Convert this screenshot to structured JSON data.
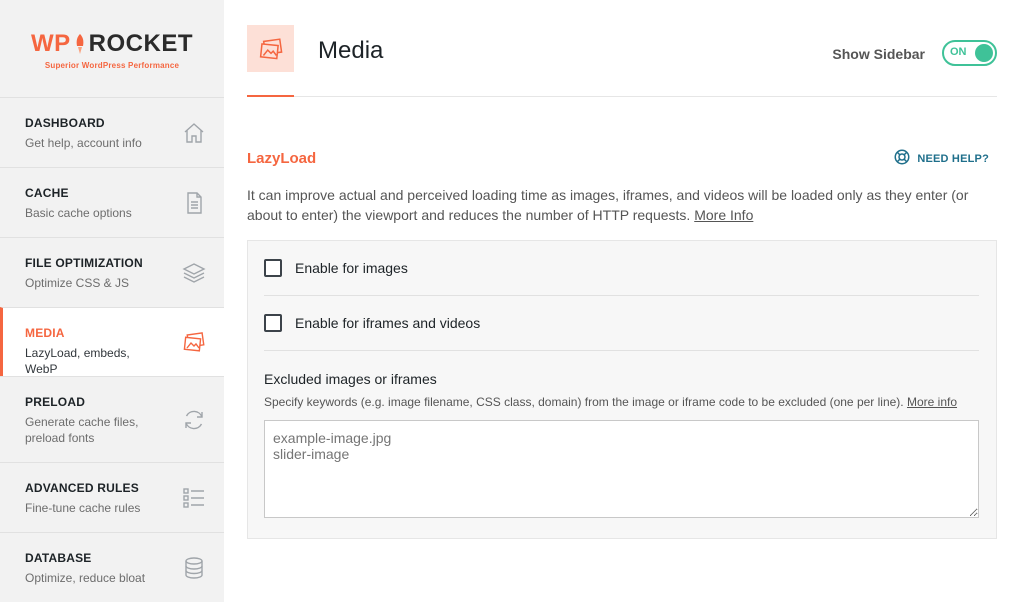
{
  "logo": {
    "brand_wp": "WP",
    "brand_rocket": "ROCKET",
    "tagline": "Superior WordPress Performance"
  },
  "sidebar": {
    "items": [
      {
        "title": "DASHBOARD",
        "desc": "Get help, account info",
        "icon": "home-icon"
      },
      {
        "title": "CACHE",
        "desc": "Basic cache options",
        "icon": "document-icon"
      },
      {
        "title": "FILE OPTIMIZATION",
        "desc": "Optimize CSS & JS",
        "icon": "layers-icon"
      },
      {
        "title": "MEDIA",
        "desc": "LazyLoad, embeds, WebP",
        "icon": "images-icon",
        "active": true
      },
      {
        "title": "PRELOAD",
        "desc": "Generate cache files, preload fonts",
        "icon": "refresh-icon"
      },
      {
        "title": "ADVANCED RULES",
        "desc": "Fine-tune cache rules",
        "icon": "checklist-icon"
      },
      {
        "title": "DATABASE",
        "desc": "Optimize, reduce bloat",
        "icon": "database-icon"
      }
    ]
  },
  "header": {
    "title": "Media",
    "show_sidebar_label": "Show Sidebar",
    "toggle_state": "ON"
  },
  "section": {
    "title": "LazyLoad",
    "need_help": "NEED HELP?",
    "description": "It can improve actual and perceived loading time as images, iframes, and videos will be loaded only as they enter (or about to enter) the viewport and reduces the number of HTTP requests.",
    "more_info": "More Info"
  },
  "options": {
    "images_label": "Enable for images",
    "images_checked": false,
    "iframes_label": "Enable for iframes and videos",
    "iframes_checked": false
  },
  "excluded": {
    "label": "Excluded images or iframes",
    "description": "Specify keywords (e.g. image filename, CSS class, domain) from the image or iframe code to be excluded (one per line).",
    "more_info": "More info",
    "placeholder": "example-image.jpg\nslider-image"
  },
  "colors": {
    "accent": "#f56640",
    "toggle_on": "#3fc298",
    "help_link": "#1f6f8b",
    "sidebar_bg": "#f2f2f2",
    "panel_bg": "#f7f7f7"
  }
}
